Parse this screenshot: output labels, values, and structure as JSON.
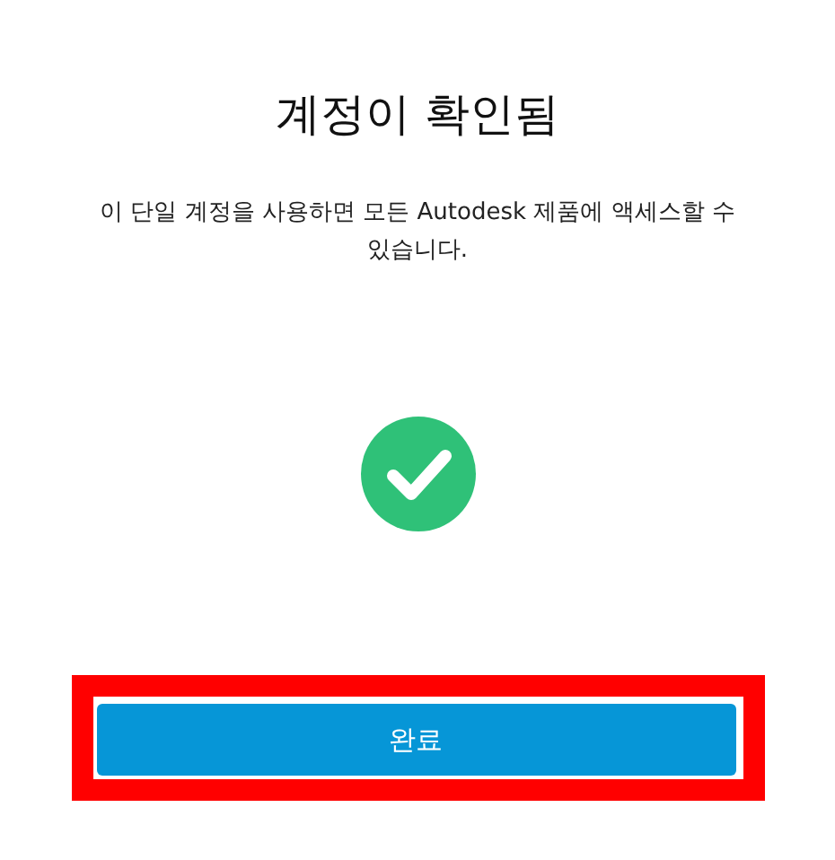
{
  "title": "계정이 확인됨",
  "message": "이 단일 계정을 사용하면 모든 Autodesk 제품에 액세스할 수 있습니다.",
  "status": {
    "kind": "success",
    "color": "#2fc178"
  },
  "button": {
    "label": "완료",
    "highlighted": true
  }
}
